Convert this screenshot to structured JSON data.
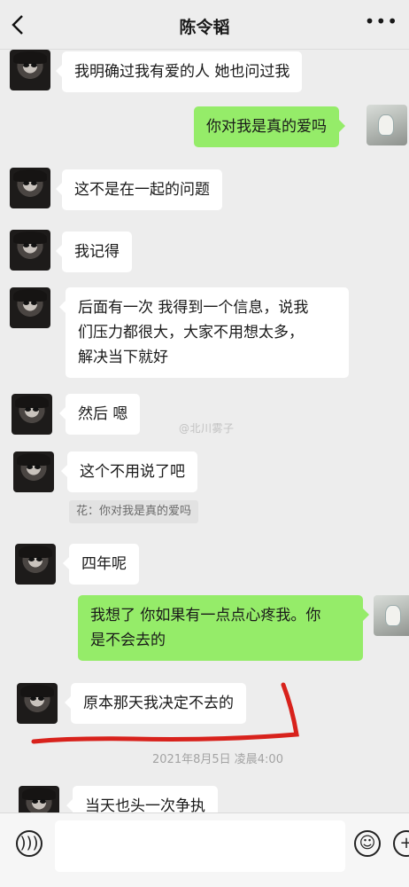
{
  "header": {
    "title": "陈令韬",
    "back_icon": "chevron-left-icon",
    "more_icon": "ellipsis-icon"
  },
  "messages": [
    {
      "side": "left",
      "text": "我明确过我有爱的人 她也问过我"
    },
    {
      "side": "right",
      "text": "你对我是真的爱吗"
    },
    {
      "side": "left",
      "text": "这不是在一起的问题"
    },
    {
      "side": "left",
      "text": "我记得"
    },
    {
      "side": "left",
      "lines": [
        "后面有一次 我得到一个信息，说我",
        "们压力都很大，大家不用想太多，",
        "解决当下就好"
      ]
    },
    {
      "side": "left",
      "text": "然后 嗯"
    },
    {
      "side": "left",
      "text": "这个不用说了吧",
      "quote": "花：你对我是真的爱吗"
    },
    {
      "side": "left",
      "text": "四年呢"
    },
    {
      "side": "right",
      "lines": [
        "我想了 你如果有一点点心疼我。你",
        "是不会去的"
      ]
    },
    {
      "side": "left",
      "text": "原本那天我决定不去的"
    },
    {
      "side": "left",
      "text": "当天也头一次争执"
    }
  ],
  "timestamp": "2021年8月5日 凌晨4:00",
  "watermark": "@北川雾子",
  "annotation_color": "#d8221c",
  "colors": {
    "background": "#ededed",
    "sent_bubble": "#95ec69",
    "received_bubble": "#ffffff"
  },
  "footer": {
    "voice_icon": "voice-icon",
    "emoji_icon": "emoji-icon",
    "plus_icon": "plus-icon"
  }
}
